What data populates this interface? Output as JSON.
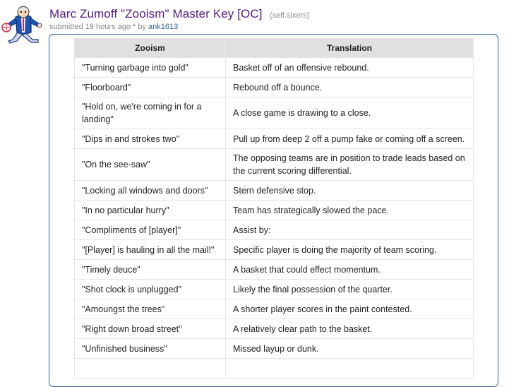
{
  "post": {
    "title": "Marc Zumoff \"Zooism\" Master Key [OC]",
    "domain": "(self.sixers)",
    "submitted": "submitted 19 hours ago * by",
    "author": "ank1613",
    "thumbnail_icon": "sixers-mascot-logo"
  },
  "table": {
    "headers": [
      "Zooism",
      "Translation"
    ],
    "rows": [
      [
        "\"Turning garbage into gold\"",
        "Basket off of an offensive rebound."
      ],
      [
        "\"Floorboard\"",
        "Rebound off a bounce."
      ],
      [
        "\"Hold on, we're coming in for a landing\"",
        "A close game is drawing to a close."
      ],
      [
        "\"Dips in and strokes two\"",
        "Pull up from deep 2 off a pump fake or coming off a screen."
      ],
      [
        "\"On the see-saw\"",
        "The opposing teams are in position to trade leads based on the current scoring differential."
      ],
      [
        "\"Locking all windows and doors\"",
        "Stern defensive stop."
      ],
      [
        "\"In no particular hurry\"",
        "Team has strategically slowed the pace."
      ],
      [
        "\"Compliments of [player]\"",
        "Assist by:"
      ],
      [
        "\"[Player] is hauling in all the mail!\"",
        "Specific player is doing the majority of team scoring."
      ],
      [
        "\"Timely deuce\"",
        "A basket that could effect momentum."
      ],
      [
        "\"Shot clock is unplugged\"",
        "Likely the final possession of the quarter."
      ],
      [
        "\"Amoungst the trees\"",
        "A shorter player scores in the paint contested."
      ],
      [
        "\"Right down broad street\"",
        "A relatively clear path to the basket."
      ],
      [
        "\"Unfinished business\"",
        "Missed layup or dunk."
      ],
      [
        "",
        ""
      ]
    ]
  }
}
